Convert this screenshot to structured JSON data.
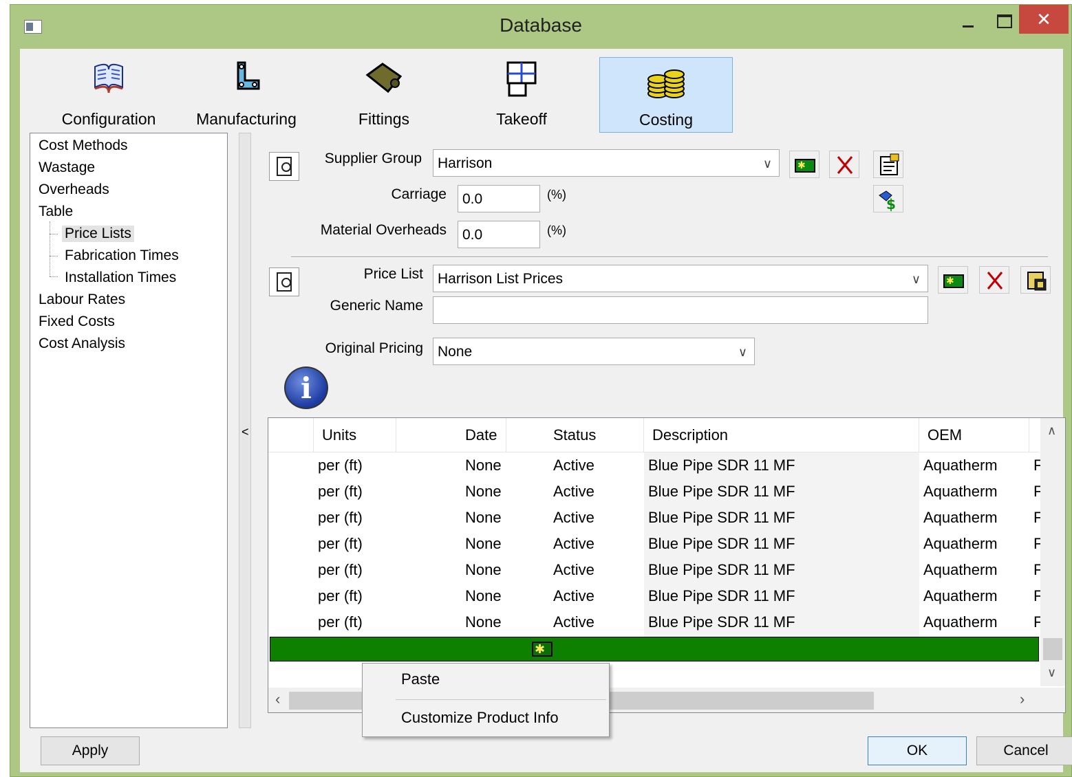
{
  "window": {
    "title": "Database"
  },
  "tabs": [
    {
      "label": "Configuration",
      "icon": "book-icon"
    },
    {
      "label": "Manufacturing",
      "icon": "manufacturing-icon"
    },
    {
      "label": "Fittings",
      "icon": "fittings-icon"
    },
    {
      "label": "Takeoff",
      "icon": "takeoff-icon"
    },
    {
      "label": "Costing",
      "icon": "coins-icon",
      "selected": true
    }
  ],
  "tree": {
    "items": [
      "Cost Methods",
      "Wastage",
      "Overheads",
      "Table",
      "Price Lists",
      "Fabrication Times",
      "Installation Times",
      "Labour Rates",
      "Fixed Costs",
      "Cost Analysis"
    ],
    "selected": "Price Lists"
  },
  "splitter": {
    "glyph": "<"
  },
  "supplier": {
    "group_label": "Supplier Group",
    "group_value": "Harrison",
    "carriage_label": "Carriage",
    "carriage_value": "0.0",
    "carriage_unit": "(%)",
    "overheads_label": "Material Overheads",
    "overheads_value": "0.0",
    "overheads_unit": "(%)"
  },
  "pricelist": {
    "label": "Price List",
    "value": "Harrison List Prices",
    "generic_label": "Generic Name",
    "generic_value": "",
    "original_label": "Original Pricing",
    "original_value": "None"
  },
  "grid": {
    "columns": [
      "Units",
      "Date",
      "Status",
      "Description",
      "OEM"
    ],
    "rows": [
      {
        "units": "per (ft)",
        "date": "None",
        "status": "Active",
        "description": "Blue Pipe SDR 11 MF",
        "oem": "Aquatherm",
        "extra": "F"
      },
      {
        "units": "per (ft)",
        "date": "None",
        "status": "Active",
        "description": "Blue Pipe SDR 11 MF",
        "oem": "Aquatherm",
        "extra": "F"
      },
      {
        "units": "per (ft)",
        "date": "None",
        "status": "Active",
        "description": "Blue Pipe SDR 11 MF",
        "oem": "Aquatherm",
        "extra": "F"
      },
      {
        "units": "per (ft)",
        "date": "None",
        "status": "Active",
        "description": "Blue Pipe SDR 11 MF",
        "oem": "Aquatherm",
        "extra": "F"
      },
      {
        "units": "per (ft)",
        "date": "None",
        "status": "Active",
        "description": "Blue Pipe SDR 11 MF",
        "oem": "Aquatherm",
        "extra": "F"
      },
      {
        "units": "per (ft)",
        "date": "None",
        "status": "Active",
        "description": "Blue Pipe SDR 11 MF",
        "oem": "Aquatherm",
        "extra": "F"
      },
      {
        "units": "per (ft)",
        "date": "None",
        "status": "Active",
        "description": "Blue Pipe SDR 11 MF",
        "oem": "Aquatherm",
        "extra": "F"
      }
    ],
    "new_row_color": "#0d8000"
  },
  "context_menu": {
    "items": [
      "Paste",
      "Customize Product Info"
    ]
  },
  "buttons": {
    "apply": "Apply",
    "ok": "OK",
    "cancel": "Cancel"
  },
  "colors": {
    "titlebar": "#adc884",
    "close": "#c7483f",
    "selected_tab": "#cfe5fb"
  }
}
